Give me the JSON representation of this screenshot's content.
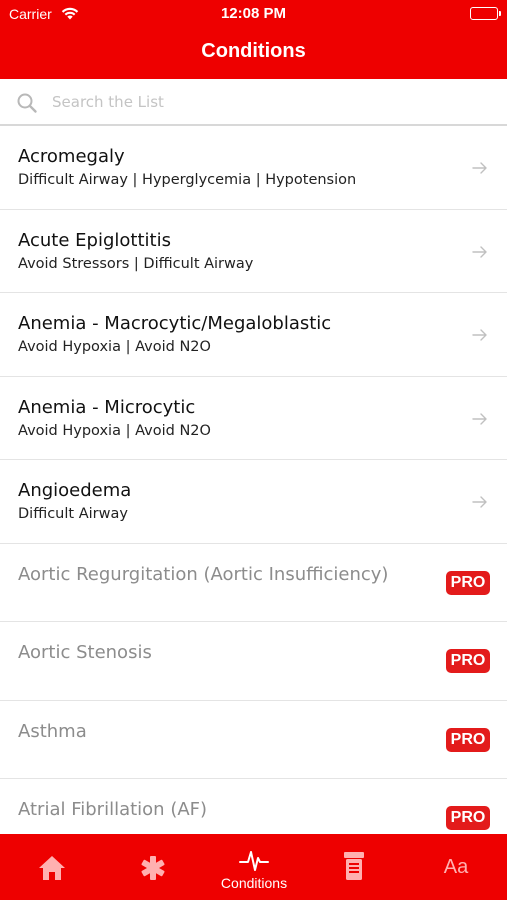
{
  "status_bar": {
    "carrier": "Carrier",
    "time": "12:08 PM"
  },
  "header": {
    "title": "Conditions"
  },
  "search": {
    "placeholder": "Search the List",
    "value": ""
  },
  "conditions": [
    {
      "name": "Acromegaly",
      "tags": "Difficult Airway | Hyperglycemia | Hypotension",
      "locked": false
    },
    {
      "name": "Acute Epiglottitis",
      "tags": "Avoid Stressors | Difficult Airway",
      "locked": false
    },
    {
      "name": "Anemia - Macrocytic/Megaloblastic",
      "tags": "Avoid Hypoxia | Avoid N2O",
      "locked": false
    },
    {
      "name": "Anemia - Microcytic",
      "tags": "Avoid Hypoxia | Avoid N2O",
      "locked": false
    },
    {
      "name": "Angioedema",
      "tags": "Difficult Airway",
      "locked": false
    },
    {
      "name": "Aortic Regurgitation (Aortic Insufficiency)",
      "badge": "PRO",
      "locked": true
    },
    {
      "name": "Aortic Stenosis",
      "badge": "PRO",
      "locked": true
    },
    {
      "name": "Asthma",
      "badge": "PRO",
      "locked": true
    },
    {
      "name": "Atrial Fibrillation (AF)",
      "badge": "PRO",
      "locked": true
    }
  ],
  "tab_bar": {
    "active": "conditions",
    "tabs": [
      {
        "id": "home",
        "icon": "home-icon",
        "label": ""
      },
      {
        "id": "medical",
        "icon": "asterisk-icon",
        "label": ""
      },
      {
        "id": "conditions",
        "icon": "heartbeat-icon",
        "label": "Conditions"
      },
      {
        "id": "drugs",
        "icon": "pill-bottle-icon",
        "label": ""
      },
      {
        "id": "text-size",
        "icon": "text-size-icon",
        "label": "Aa"
      }
    ]
  },
  "colors": {
    "brand_red": "#ee0000",
    "pro_badge": "#e31b1b",
    "locked_text": "#8c8c8c",
    "inactive_tab_icon": "#ffb0b0"
  }
}
